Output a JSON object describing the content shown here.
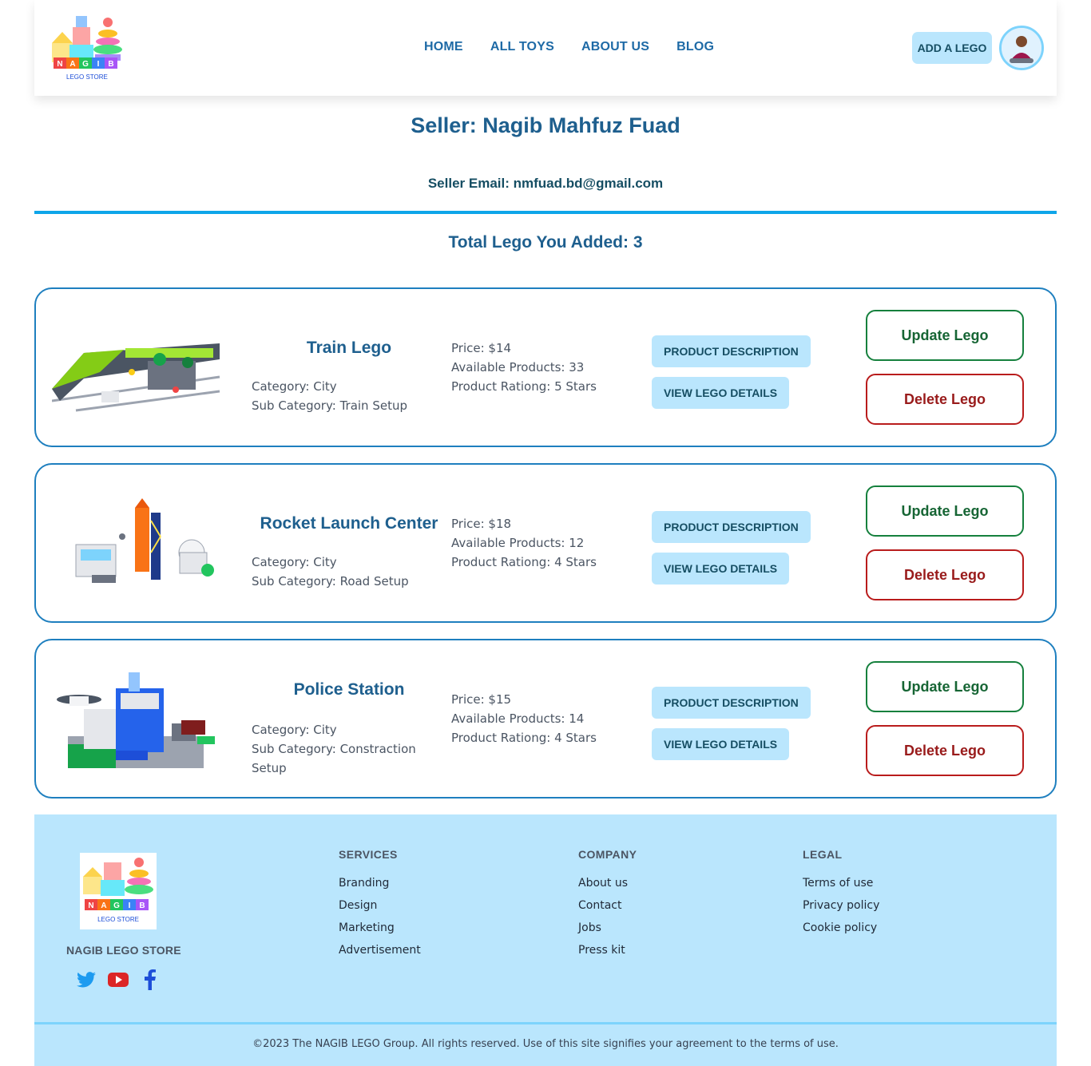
{
  "navbar": {
    "logo_text": "LEGO STORE",
    "logo_letters": [
      "N",
      "A",
      "G",
      "I",
      "B"
    ],
    "links": [
      "HOME",
      "ALL TOYS",
      "ABOUT US",
      "BLOG"
    ],
    "add_button": "ADD A LEGO"
  },
  "seller": {
    "name_line": "Seller: Nagib Mahfuz Fuad",
    "email_line": "Seller Email: nmfuad.bd@gmail.com",
    "total_line": "Total Lego You Added: 3"
  },
  "products": [
    {
      "name": "Train Lego",
      "category": "Category: City",
      "sub_category": "Sub Category: Train Setup",
      "price": "Price: $14",
      "available": "Available Products: 33",
      "rating": "Product Rationg: 5 Stars",
      "image_icon": "train-lego-image"
    },
    {
      "name": "Rocket Launch Center",
      "category": "Category: City",
      "sub_category": "Sub Category: Road Setup",
      "price": "Price: $18",
      "available": "Available Products: 12",
      "rating": "Product Rationg: 4 Stars",
      "image_icon": "rocket-lego-image"
    },
    {
      "name": "Police Station",
      "category": "Category: City",
      "sub_category": "Sub Category: Constraction Setup",
      "price": "Price: $15",
      "available": "Available Products: 14",
      "rating": "Product Rationg: 4 Stars",
      "image_icon": "police-station-lego-image"
    }
  ],
  "card_actions": {
    "description": "PRODUCT DESCRIPTION",
    "details": "VIEW LEGO DETAILS",
    "update": "Update Lego",
    "delete": "Delete Lego"
  },
  "footer": {
    "brand": "NAGIB LEGO STORE",
    "logo_text": "LEGO STORE",
    "socials": [
      "twitter-icon",
      "youtube-icon",
      "facebook-icon"
    ],
    "services": {
      "title": "SERVICES",
      "items": [
        "Branding",
        "Design",
        "Marketing",
        "Advertisement"
      ]
    },
    "company": {
      "title": "COMPANY",
      "items": [
        "About us",
        "Contact",
        "Jobs",
        "Press kit"
      ]
    },
    "legal": {
      "title": "LEGAL",
      "items": [
        "Terms of use",
        "Privacy policy",
        "Cookie policy"
      ]
    },
    "copyright": "©2023 The NAGIB LEGO Group. All rights reserved. Use of this site signifies your agreement to the terms of use."
  },
  "colors": {
    "accent": "#0ea5e9",
    "light_button": "#bae6fd",
    "heading": "#1e5f8e",
    "update": "#15803d",
    "delete": "#b91c1c"
  }
}
